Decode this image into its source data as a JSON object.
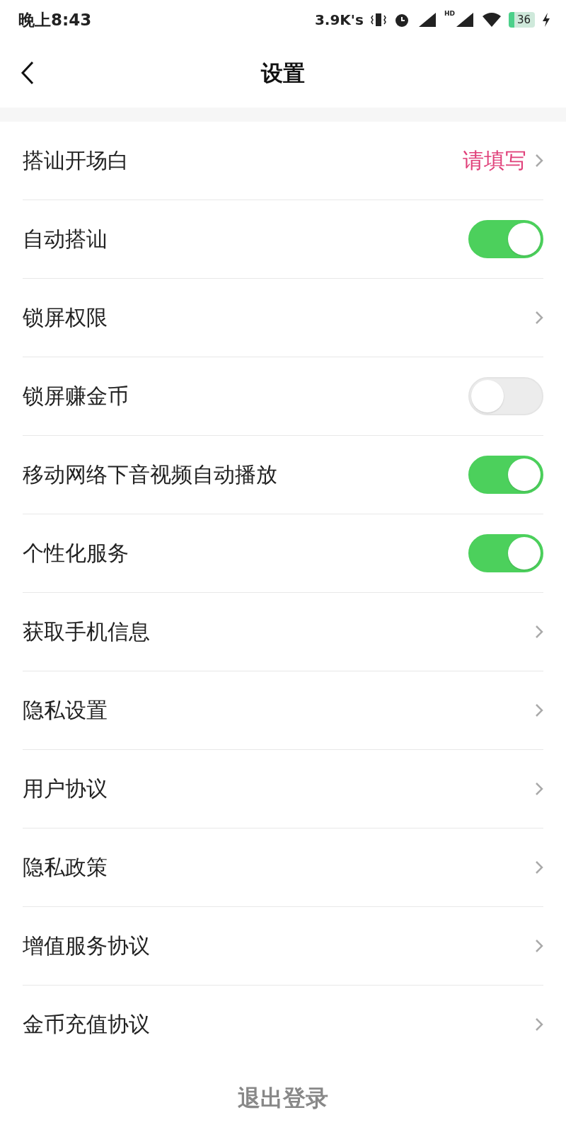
{
  "status_bar": {
    "time": "晚上8:43",
    "speed": "3.9K's",
    "network_badge": "HD",
    "battery": "36"
  },
  "header": {
    "title": "设置"
  },
  "rows": [
    {
      "kind": "link",
      "label": "搭讪开场白",
      "value": "请填写"
    },
    {
      "kind": "toggle",
      "label": "自动搭讪",
      "on": true
    },
    {
      "kind": "link",
      "label": "锁屏权限"
    },
    {
      "kind": "toggle",
      "label": "锁屏赚金币",
      "on": false
    },
    {
      "kind": "toggle",
      "label": "移动网络下音视频自动播放",
      "on": true
    },
    {
      "kind": "toggle",
      "label": "个性化服务",
      "on": true
    },
    {
      "kind": "link",
      "label": "获取手机信息"
    },
    {
      "kind": "link",
      "label": "隐私设置"
    },
    {
      "kind": "link",
      "label": "用户协议"
    },
    {
      "kind": "link",
      "label": "隐私政策"
    },
    {
      "kind": "link",
      "label": "增值服务协议"
    },
    {
      "kind": "link",
      "label": "金币充值协议"
    }
  ],
  "logout": "退出登录"
}
